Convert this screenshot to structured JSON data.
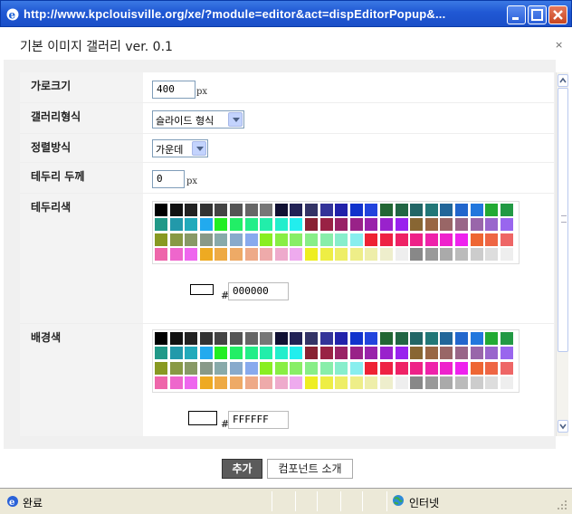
{
  "window": {
    "title": "http://www.kpclouisville.org/xe/?module=editor&act=dispEditorPopup&..."
  },
  "popup": {
    "title": "기본 이미지 갤러리 ver. 0.1",
    "close": "×"
  },
  "form": {
    "width": {
      "label": "가로크기",
      "value": "400",
      "unit": "px"
    },
    "gallery_style": {
      "label": "갤러리형식",
      "selected": "슬라이드 형식"
    },
    "align": {
      "label": "정렬방식",
      "selected": "가운데"
    },
    "border_thickness": {
      "label": "테두리 두께",
      "value": "0",
      "unit": "px"
    },
    "border_color": {
      "label": "테두리색",
      "hash": "#",
      "value": "000000",
      "preview_color": "#ffffff"
    },
    "bg_color": {
      "label": "배경색",
      "hash": "#",
      "value": "FFFFFF",
      "preview_color": "#ffffff"
    }
  },
  "palette": [
    [
      "#000000",
      "#111111",
      "#222222",
      "#333333",
      "#444444",
      "#555555",
      "#666666",
      "#777777",
      "#111133",
      "#222255",
      "#333366",
      "#333399",
      "#2222aa",
      "#1133cc",
      "#2244dd",
      "#226633",
      "#226644",
      "#226666",
      "#227777",
      "#226699",
      "#2266cc",
      "#2277dd",
      "#22aa33",
      "#229944"
    ],
    [
      "#229988",
      "#2299aa",
      "#22aabb",
      "#22aaee",
      "#22ee22",
      "#22ee66",
      "#22ee88",
      "#22eeaa",
      "#22eecc",
      "#22eeee",
      "#882233",
      "#992244",
      "#992266",
      "#992288",
      "#9922aa",
      "#9922cc",
      "#9922ee",
      "#886633",
      "#996644",
      "#996666",
      "#996688",
      "#9966aa",
      "#9966cc",
      "#9966ee"
    ],
    [
      "#889922",
      "#889944",
      "#889966",
      "#889988",
      "#88aaaa",
      "#88aacc",
      "#88aaee",
      "#88ee22",
      "#88ee44",
      "#88ee66",
      "#88ee88",
      "#88eeaa",
      "#88eecc",
      "#88eeee",
      "#ee2233",
      "#ee2244",
      "#ee2266",
      "#ee2288",
      "#ee22aa",
      "#ee22cc",
      "#ee22ee",
      "#ee6633",
      "#ee6644",
      "#ee6666"
    ],
    [
      "#ee66aa",
      "#ee66cc",
      "#ee66ee",
      "#eeaa22",
      "#eeaa44",
      "#eeaa66",
      "#eeaa88",
      "#eeaaaa",
      "#eeaacc",
      "#eeaaee",
      "#eeee22",
      "#eeee44",
      "#eeee66",
      "#eeee88",
      "#eeeeaa",
      "#eeeecc",
      "#eeeeee",
      "#888888",
      "#999999",
      "#aaaaaa",
      "#bbbbbb",
      "#cccccc",
      "#dddddd",
      "#eeeeee"
    ]
  ],
  "buttons": {
    "add": "추가",
    "component_info": "컴포넌트 소개"
  },
  "statusbar": {
    "status": "완료",
    "zone": "인터넷"
  },
  "colors": {
    "titlebar": "#2058d4",
    "add_button": "#5b5b5b"
  }
}
